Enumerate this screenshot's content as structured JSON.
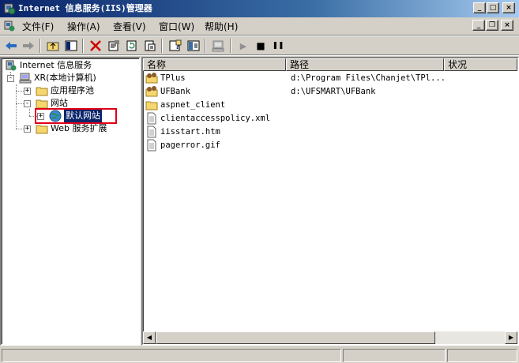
{
  "window": {
    "title": "Internet 信息服务(IIS)管理器",
    "controls": {
      "minimize": "_",
      "maximize": "□",
      "close": "×"
    }
  },
  "menu": {
    "items": [
      {
        "label": "文件(F)"
      },
      {
        "label": "操作(A)"
      },
      {
        "label": "查看(V)"
      },
      {
        "label": "窗口(W)"
      },
      {
        "label": "帮助(H)"
      }
    ],
    "mdi_controls": {
      "minimize": "_",
      "restore": "❐",
      "close": "×"
    }
  },
  "toolbar": {
    "buttons": [
      "back-icon",
      "forward-icon",
      "up-folder-icon",
      "show-tree-icon",
      "delete-icon",
      "properties-icon",
      "refresh-icon",
      "export-icon",
      "help-icon",
      "console-icon",
      "computer-icon",
      "play-icon",
      "stop-icon",
      "pause-icon"
    ],
    "play": "▶",
    "stop": "■",
    "pause": "❚❚"
  },
  "tree": {
    "root": "Internet 信息服务",
    "computer": "XR(本地计算机)",
    "app_pools": "应用程序池",
    "websites": "网站",
    "default_site": "默认网站",
    "web_extensions": "Web 服务扩展",
    "expand_plus": "+",
    "expand_minus": "-"
  },
  "list": {
    "columns": [
      "名称",
      "路径",
      "状况"
    ],
    "rows": [
      {
        "name": "TPlus",
        "path": "d:\\Program Files\\Chanjet\\TPl...",
        "icon": "virtual-directory-icon"
      },
      {
        "name": "UFBank",
        "path": "d:\\UFSMART\\UFBank",
        "icon": "virtual-directory-icon"
      },
      {
        "name": "aspnet_client",
        "path": "",
        "icon": "folder-icon"
      },
      {
        "name": "clientaccesspolicy.xml",
        "path": "",
        "icon": "file-icon"
      },
      {
        "name": "iisstart.htm",
        "path": "",
        "icon": "file-icon"
      },
      {
        "name": "pagerror.gif",
        "path": "",
        "icon": "file-icon"
      }
    ]
  },
  "colors": {
    "title_start": "#0a246a",
    "title_end": "#a6caf0",
    "selection": "#0a246a",
    "highlight_box": "#e0001a",
    "chrome": "#d4d0c8"
  }
}
